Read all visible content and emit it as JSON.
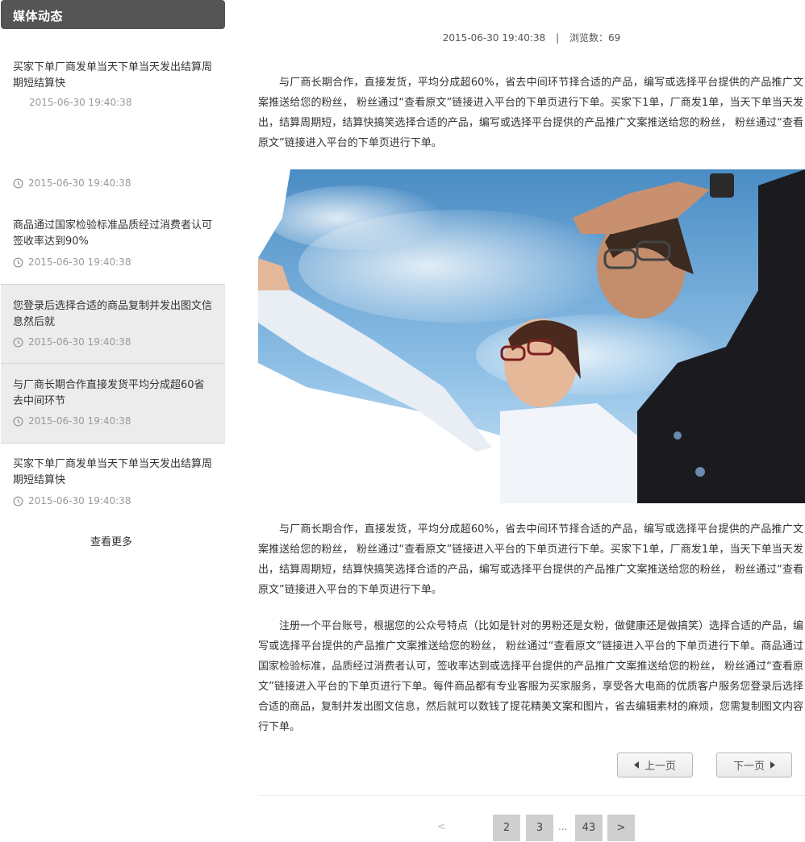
{
  "sidebar": {
    "title": "媒体动态",
    "items": [
      {
        "title": "买家下单厂商发单当天下单当天发出结算周期短结算快",
        "date": "2015-06-30 19:40:38"
      },
      {
        "title": "",
        "date": "2015-06-30 19:40:38"
      },
      {
        "title": "商品通过国家检验标准品质经过消费者认可签收率达到90%",
        "date": "2015-06-30 19:40:38"
      },
      {
        "title": "您登录后选择合适的商品复制并发出图文信息然后就",
        "date": "2015-06-30 19:40:38"
      },
      {
        "title": "与厂商长期合作直接发货平均分成超60省去中间环节",
        "date": "2015-06-30 19:40:38"
      },
      {
        "title": "买家下单厂商发单当天下单当天发出结算周期短结算快",
        "date": "2015-06-30 19:40:38"
      }
    ],
    "more": "查看更多"
  },
  "article": {
    "date": "2015-06-30 19:40:38",
    "separator": "|",
    "views": "浏览数：69",
    "para1": "与厂商长期合作，直接发货，平均分成超60%，省去中间环节择合适的产品，编写或选择平台提供的产品推广文案推送给您的粉丝， 粉丝通过“查看原文”链接进入平台的下单页进行下单。买家下1单，厂商发1单，当天下单当天发出，结算周期短，结算快搞笑选择合适的产品，编写或选择平台提供的产品推广文案推送给您的粉丝， 粉丝通过“查看原文”链接进入平台的下单页进行下单。",
    "para2": "与厂商长期合作，直接发货，平均分成超60%，省去中间环节择合适的产品，编写或选择平台提供的产品推广文案推送给您的粉丝， 粉丝通过“查看原文”链接进入平台的下单页进行下单。买家下1单，厂商发1单，当天下单当天发出，结算周期短，结算快搞笑选择合适的产品，编写或选择平台提供的产品推广文案推送给您的粉丝， 粉丝通过“查看原文”链接进入平台的下单页进行下单。",
    "para3": "注册一个平台账号，根据您的公众号特点（比如是针对的男粉还是女粉，做健康还是做搞笑）选择合适的产品，编写或选择平台提供的产品推广文案推送给您的粉丝， 粉丝通过“查看原文”链接进入平台的下单页进行下单。商品通过国家检验标准，品质经过消费者认可，签收率达到或选择平台提供的产品推广文案推送给您的粉丝， 粉丝通过“查看原文”链接进入平台的下单页进行下单。每件商品都有专业客服为买家服务，享受各大电商的优质客户服务您登录后选择合适的商品，复制并发出图文信息，然后就可以数钱了提花精美文案和图片，省去编辑素材的麻烦，您需复制图文内容行下单。",
    "prev_label": "上一页",
    "next_label": "下一页"
  },
  "pagination": {
    "prev": "<",
    "pages": [
      "2",
      "3",
      "43"
    ],
    "dots": "...",
    "next": ">"
  }
}
